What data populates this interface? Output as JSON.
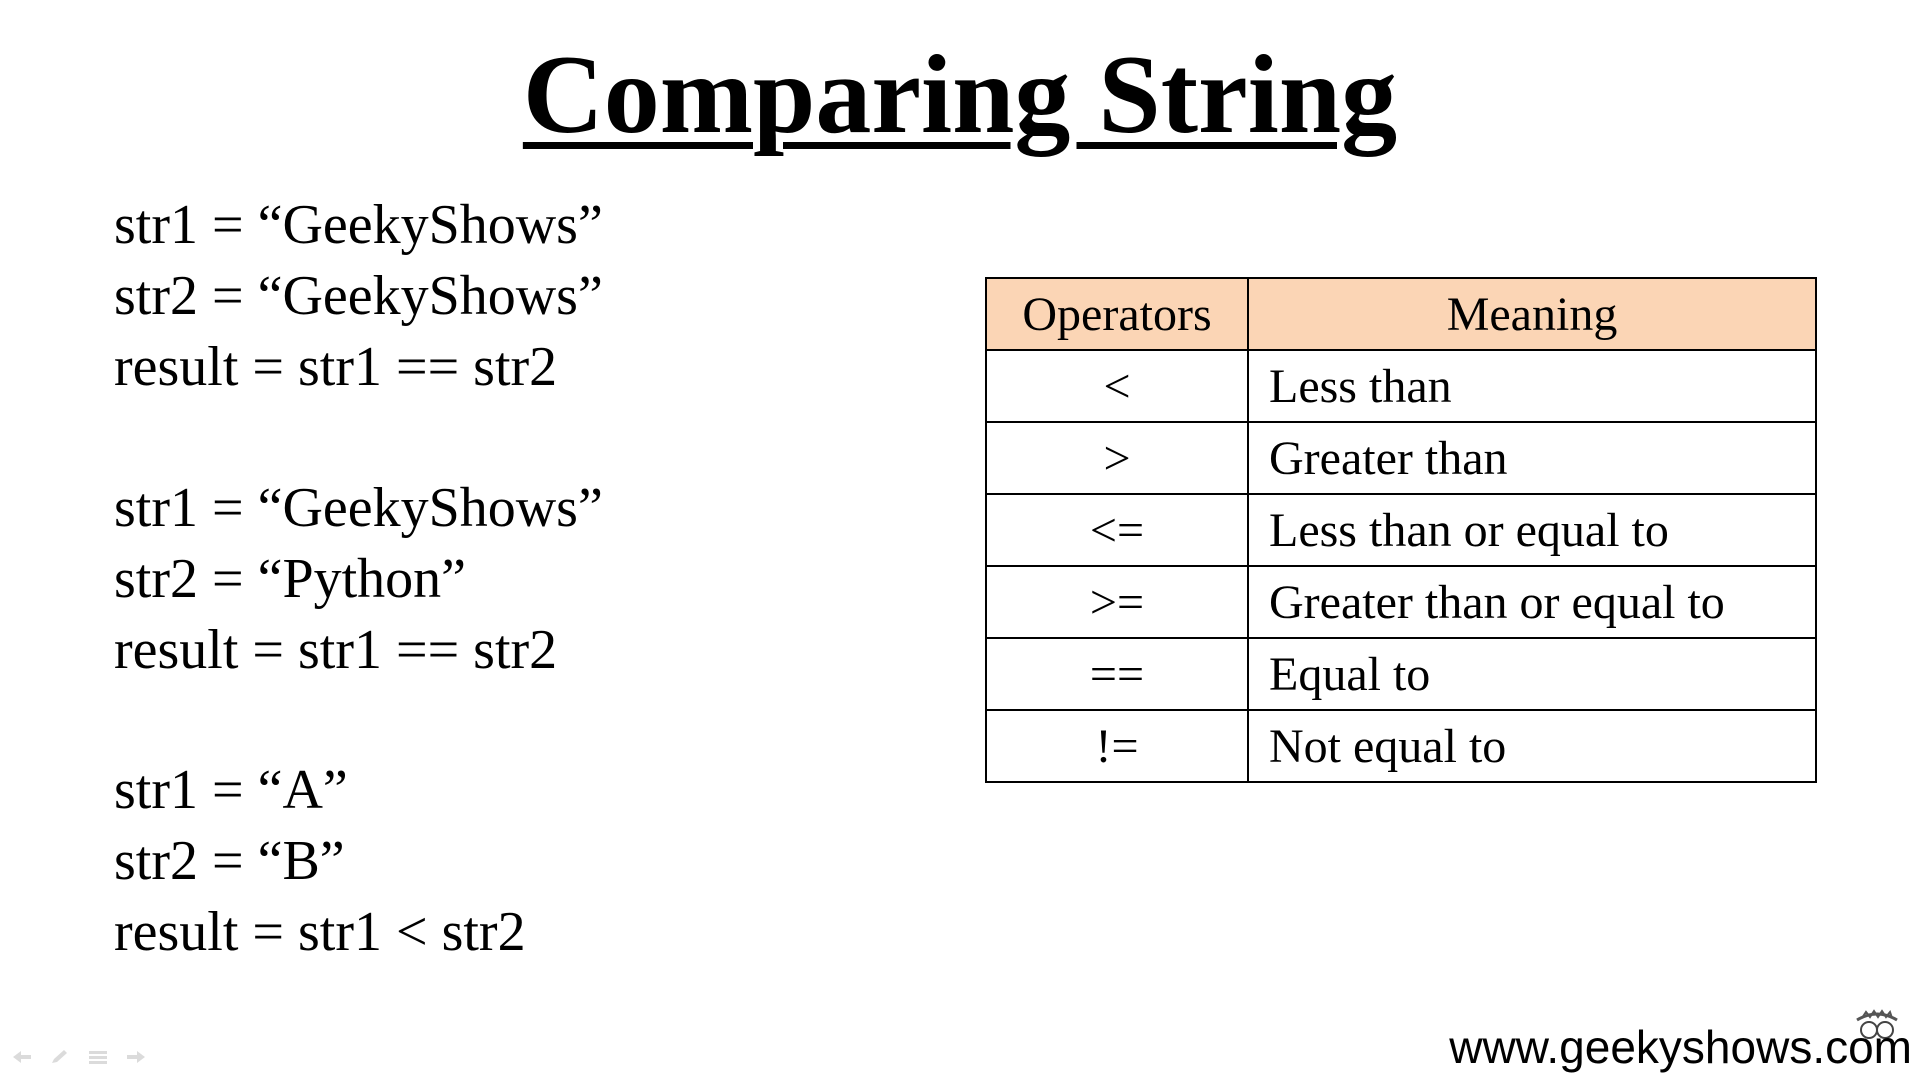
{
  "slide": {
    "title": "Comparing String"
  },
  "code_blocks": [
    {
      "lines": [
        "str1 = “GeekyShows”",
        "str2 = “GeekyShows”",
        "result = str1 == str2"
      ]
    },
    {
      "lines": [
        "str1 = “GeekyShows”",
        "str2 = “Python”",
        "result = str1 == str2"
      ]
    },
    {
      "lines": [
        "str1 = “A”",
        "str2 = “B”",
        "result = str1 < str2"
      ]
    }
  ],
  "operators_table": {
    "headers": [
      "Operators",
      "Meaning"
    ],
    "header_color": "#fbd5b5",
    "rows": [
      {
        "operator": "<",
        "meaning": "Less than"
      },
      {
        "operator": ">",
        "meaning": "Greater than"
      },
      {
        "operator": "<=",
        "meaning": "Less than or equal to"
      },
      {
        "operator": ">=",
        "meaning": "Greater than or equal to"
      },
      {
        "operator": "==",
        "meaning": "Equal to"
      },
      {
        "operator": "!=",
        "meaning": "Not equal to"
      }
    ]
  },
  "controls": {
    "icons": [
      "previous-arrow-icon",
      "pen-icon",
      "menu-icon",
      "next-arrow-icon"
    ]
  },
  "watermark": {
    "text": "www.geekyshows.com",
    "icon": "geekyshows-logo-icon"
  }
}
